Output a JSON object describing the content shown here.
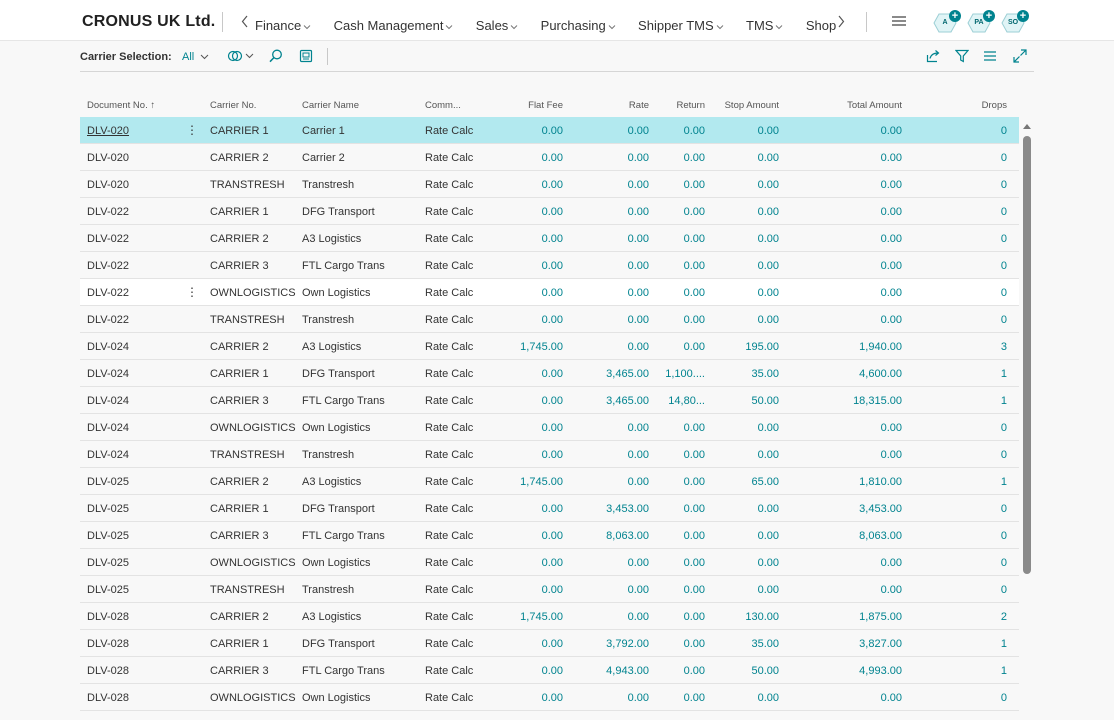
{
  "app": {
    "company": "CRONUS UK Ltd."
  },
  "nav": {
    "items": [
      "Finance",
      "Cash Management",
      "Sales",
      "Purchasing",
      "Shipper TMS",
      "TMS",
      "Shopify"
    ]
  },
  "users": [
    {
      "initials": "A"
    },
    {
      "initials": "PA"
    },
    {
      "initials": "SO"
    }
  ],
  "toolbar": {
    "label": "Carrier Selection:",
    "filter_value": "All"
  },
  "table": {
    "columns": {
      "doc": "Document No. ↑",
      "carrier_no": "Carrier No.",
      "carrier_name": "Carrier Name",
      "comm": "Comm...",
      "flat": "Flat Fee",
      "rate": "Rate",
      "ret": "Return",
      "stop": "Stop Amount",
      "total": "Total Amount",
      "drops": "Drops"
    },
    "rows": [
      {
        "doc": "DLV-020",
        "carrier_no": "CARRIER 1",
        "carrier_name": "Carrier 1",
        "comm": "Rate Calc",
        "flat": "0.00",
        "rate": "0.00",
        "ret": "0.00",
        "stop": "0.00",
        "total": "0.00",
        "drops": "0"
      },
      {
        "doc": "DLV-020",
        "carrier_no": "CARRIER 2",
        "carrier_name": "Carrier 2",
        "comm": "Rate Calc",
        "flat": "0.00",
        "rate": "0.00",
        "ret": "0.00",
        "stop": "0.00",
        "total": "0.00",
        "drops": "0"
      },
      {
        "doc": "DLV-020",
        "carrier_no": "TRANSTRESH",
        "carrier_name": "Transtresh",
        "comm": "Rate Calc",
        "flat": "0.00",
        "rate": "0.00",
        "ret": "0.00",
        "stop": "0.00",
        "total": "0.00",
        "drops": "0"
      },
      {
        "doc": "DLV-022",
        "carrier_no": "CARRIER 1",
        "carrier_name": "DFG Transport",
        "comm": "Rate Calc",
        "flat": "0.00",
        "rate": "0.00",
        "ret": "0.00",
        "stop": "0.00",
        "total": "0.00",
        "drops": "0"
      },
      {
        "doc": "DLV-022",
        "carrier_no": "CARRIER 2",
        "carrier_name": "A3 Logistics",
        "comm": "Rate Calc",
        "flat": "0.00",
        "rate": "0.00",
        "ret": "0.00",
        "stop": "0.00",
        "total": "0.00",
        "drops": "0"
      },
      {
        "doc": "DLV-022",
        "carrier_no": "CARRIER 3",
        "carrier_name": "FTL Cargo Trans",
        "comm": "Rate Calc",
        "flat": "0.00",
        "rate": "0.00",
        "ret": "0.00",
        "stop": "0.00",
        "total": "0.00",
        "drops": "0"
      },
      {
        "doc": "DLV-022",
        "carrier_no": "OWNLOGISTICS",
        "carrier_name": "Own Logistics",
        "comm": "Rate Calc",
        "flat": "0.00",
        "rate": "0.00",
        "ret": "0.00",
        "stop": "0.00",
        "total": "0.00",
        "drops": "0"
      },
      {
        "doc": "DLV-022",
        "carrier_no": "TRANSTRESH",
        "carrier_name": "Transtresh",
        "comm": "Rate Calc",
        "flat": "0.00",
        "rate": "0.00",
        "ret": "0.00",
        "stop": "0.00",
        "total": "0.00",
        "drops": "0"
      },
      {
        "doc": "DLV-024",
        "carrier_no": "CARRIER 2",
        "carrier_name": "A3 Logistics",
        "comm": "Rate Calc",
        "flat": "1,745.00",
        "rate": "0.00",
        "ret": "0.00",
        "stop": "195.00",
        "total": "1,940.00",
        "drops": "3"
      },
      {
        "doc": "DLV-024",
        "carrier_no": "CARRIER 1",
        "carrier_name": "DFG Transport",
        "comm": "Rate Calc",
        "flat": "0.00",
        "rate": "3,465.00",
        "ret": "1,100....",
        "stop": "35.00",
        "total": "4,600.00",
        "drops": "1"
      },
      {
        "doc": "DLV-024",
        "carrier_no": "CARRIER 3",
        "carrier_name": "FTL Cargo Trans",
        "comm": "Rate Calc",
        "flat": "0.00",
        "rate": "3,465.00",
        "ret": "14,80...",
        "stop": "50.00",
        "total": "18,315.00",
        "drops": "1"
      },
      {
        "doc": "DLV-024",
        "carrier_no": "OWNLOGISTICS",
        "carrier_name": "Own Logistics",
        "comm": "Rate Calc",
        "flat": "0.00",
        "rate": "0.00",
        "ret": "0.00",
        "stop": "0.00",
        "total": "0.00",
        "drops": "0"
      },
      {
        "doc": "DLV-024",
        "carrier_no": "TRANSTRESH",
        "carrier_name": "Transtresh",
        "comm": "Rate Calc",
        "flat": "0.00",
        "rate": "0.00",
        "ret": "0.00",
        "stop": "0.00",
        "total": "0.00",
        "drops": "0"
      },
      {
        "doc": "DLV-025",
        "carrier_no": "CARRIER 2",
        "carrier_name": "A3 Logistics",
        "comm": "Rate Calc",
        "flat": "1,745.00",
        "rate": "0.00",
        "ret": "0.00",
        "stop": "65.00",
        "total": "1,810.00",
        "drops": "1"
      },
      {
        "doc": "DLV-025",
        "carrier_no": "CARRIER 1",
        "carrier_name": "DFG Transport",
        "comm": "Rate Calc",
        "flat": "0.00",
        "rate": "3,453.00",
        "ret": "0.00",
        "stop": "0.00",
        "total": "3,453.00",
        "drops": "0"
      },
      {
        "doc": "DLV-025",
        "carrier_no": "CARRIER 3",
        "carrier_name": "FTL Cargo Trans",
        "comm": "Rate Calc",
        "flat": "0.00",
        "rate": "8,063.00",
        "ret": "0.00",
        "stop": "0.00",
        "total": "8,063.00",
        "drops": "0"
      },
      {
        "doc": "DLV-025",
        "carrier_no": "OWNLOGISTICS",
        "carrier_name": "Own Logistics",
        "comm": "Rate Calc",
        "flat": "0.00",
        "rate": "0.00",
        "ret": "0.00",
        "stop": "0.00",
        "total": "0.00",
        "drops": "0"
      },
      {
        "doc": "DLV-025",
        "carrier_no": "TRANSTRESH",
        "carrier_name": "Transtresh",
        "comm": "Rate Calc",
        "flat": "0.00",
        "rate": "0.00",
        "ret": "0.00",
        "stop": "0.00",
        "total": "0.00",
        "drops": "0"
      },
      {
        "doc": "DLV-028",
        "carrier_no": "CARRIER 2",
        "carrier_name": "A3 Logistics",
        "comm": "Rate Calc",
        "flat": "1,745.00",
        "rate": "0.00",
        "ret": "0.00",
        "stop": "130.00",
        "total": "1,875.00",
        "drops": "2"
      },
      {
        "doc": "DLV-028",
        "carrier_no": "CARRIER 1",
        "carrier_name": "DFG Transport",
        "comm": "Rate Calc",
        "flat": "0.00",
        "rate": "3,792.00",
        "ret": "0.00",
        "stop": "35.00",
        "total": "3,827.00",
        "drops": "1"
      },
      {
        "doc": "DLV-028",
        "carrier_no": "CARRIER 3",
        "carrier_name": "FTL Cargo Trans",
        "comm": "Rate Calc",
        "flat": "0.00",
        "rate": "4,943.00",
        "ret": "0.00",
        "stop": "50.00",
        "total": "4,993.00",
        "drops": "1"
      },
      {
        "doc": "DLV-028",
        "carrier_no": "OWNLOGISTICS",
        "carrier_name": "Own Logistics",
        "comm": "Rate Calc",
        "flat": "0.00",
        "rate": "0.00",
        "ret": "0.00",
        "stop": "0.00",
        "total": "0.00",
        "drops": "0"
      }
    ]
  },
  "colors": {
    "accent": "#00838f",
    "selected_row": "#b2e9ef",
    "active_row": "#ffffff"
  }
}
